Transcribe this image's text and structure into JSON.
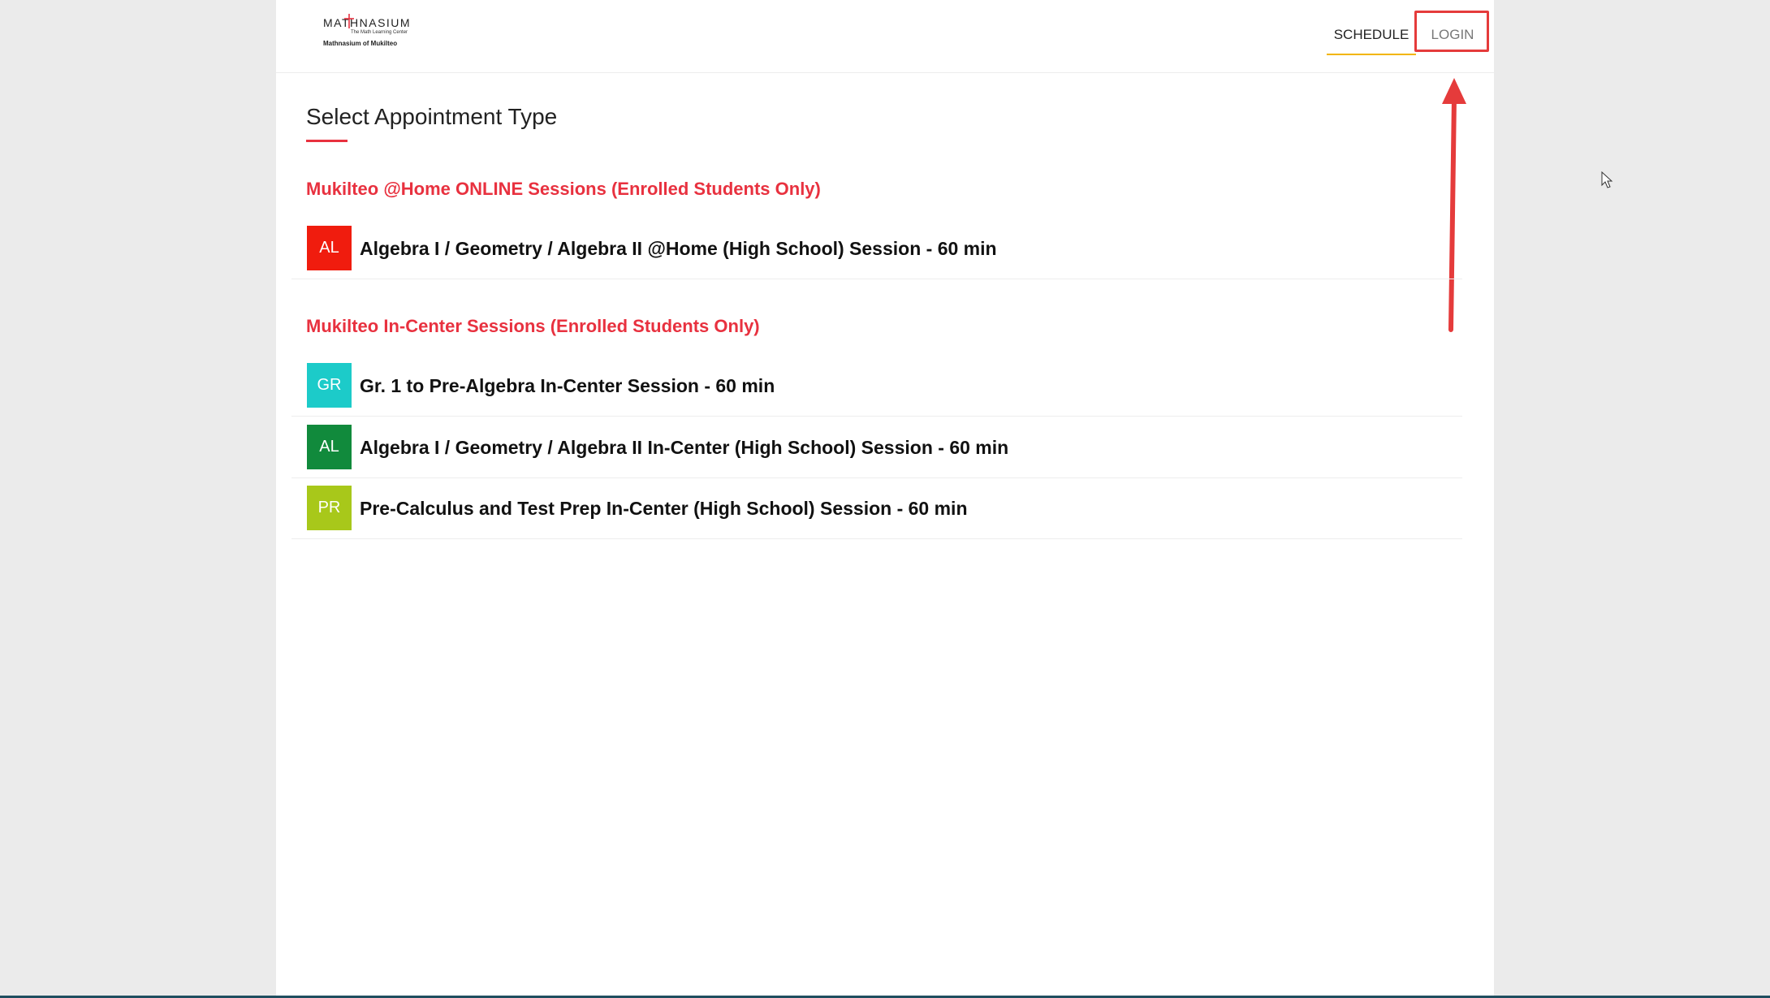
{
  "header": {
    "logo": {
      "wordmark": "MATHNASIUM",
      "tagline": "The Math Learning Center",
      "location_name": "Mathnasium of Mukilteo"
    },
    "nav": [
      {
        "label": "SCHEDULE",
        "active": true
      },
      {
        "label": "LOGIN",
        "active": false
      }
    ]
  },
  "main": {
    "title": "Select Appointment Type",
    "sections": [
      {
        "heading": "Mukilteo @Home ONLINE Sessions (Enrolled Students Only)",
        "items": [
          {
            "badge": "AL",
            "badge_color": "#f01c0e",
            "label": "Algebra I / Geometry / Algebra II @Home (High School) Session - 60 min"
          }
        ]
      },
      {
        "heading": "Mukilteo In-Center Sessions (Enrolled Students Only)",
        "items": [
          {
            "badge": "GR",
            "badge_color": "#1ccbc9",
            "label": "Gr. 1 to Pre-Algebra In-Center Session - 60 min"
          },
          {
            "badge": "AL",
            "badge_color": "#118a3c",
            "label": "Algebra I / Geometry / Algebra II In-Center (High School) Session - 60 min"
          },
          {
            "badge": "PR",
            "badge_color": "#a8c81a",
            "label": "Pre-Calculus and Test Prep In-Center (High School) Session - 60 min"
          }
        ]
      }
    ]
  },
  "annotation": {
    "highlight_color": "#e53b3b",
    "arrow_color": "#e53b3b"
  },
  "colors": {
    "accent_red": "#e8313f",
    "nav_underline": "#f2b500"
  }
}
